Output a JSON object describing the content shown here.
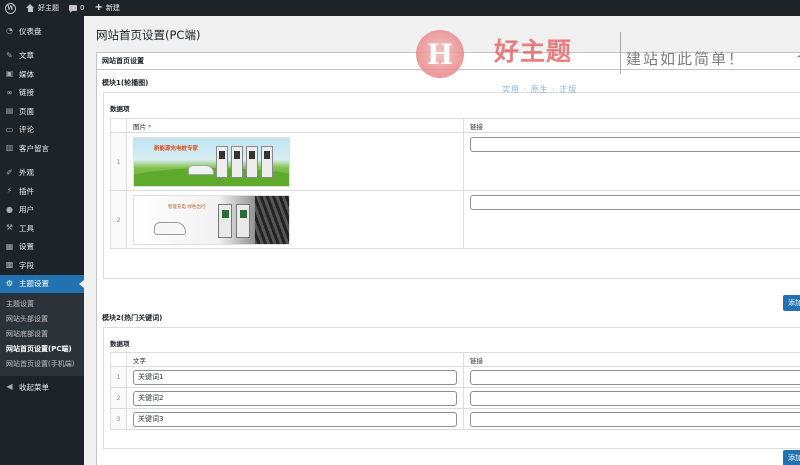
{
  "adminbar": {
    "site_name": "好主题",
    "comments_count": "0",
    "new_label": "新建"
  },
  "sidebar": {
    "items": [
      {
        "label": "仪表盘",
        "icon": "dashboard-icon"
      },
      {
        "label": "文章",
        "icon": "pin-icon"
      },
      {
        "label": "媒体",
        "icon": "media-icon"
      },
      {
        "label": "链接",
        "icon": "link-icon"
      },
      {
        "label": "页面",
        "icon": "page-icon"
      },
      {
        "label": "评论",
        "icon": "comment-icon"
      },
      {
        "label": "客户留言",
        "icon": "message-icon"
      },
      {
        "label": "外观",
        "icon": "brush-icon"
      },
      {
        "label": "插件",
        "icon": "plugin-icon"
      },
      {
        "label": "用户",
        "icon": "user-icon"
      },
      {
        "label": "工具",
        "icon": "wrench-icon"
      },
      {
        "label": "设置",
        "icon": "settings-icon"
      },
      {
        "label": "字段",
        "icon": "field-icon"
      }
    ],
    "current": {
      "label": "主题设置",
      "icon": "gear-icon"
    },
    "submenu": [
      "主题设置",
      "网站头部设置",
      "网站底部设置",
      "网站首页设置(PC端)",
      "网站首页设置(手机端)"
    ],
    "collapse_label": "收起菜单"
  },
  "page": {
    "title": "网站首页设置(PC端)",
    "panel_title": "网站首页设置"
  },
  "module1": {
    "title": "模块1(轮播图)",
    "data_label": "数据项",
    "col_image": "图片",
    "col_link": "链接",
    "rows": [
      {
        "index": "1",
        "image_text": "新能源充电桩专家",
        "link": ""
      },
      {
        "index": "2",
        "image_text": "智能充电 绿色出行",
        "link": ""
      }
    ],
    "add_label": "添加"
  },
  "module2": {
    "title": "模块2(热门关键词)",
    "data_label": "数据项",
    "col_text": "文字",
    "col_link": "链接",
    "rows": [
      {
        "index": "1",
        "text": "关键词1",
        "link": ""
      },
      {
        "index": "2",
        "text": "关键词2",
        "link": ""
      },
      {
        "index": "3",
        "text": "关键词3",
        "link": ""
      }
    ],
    "add_label": "添加"
  },
  "watermark": {
    "letter": "H",
    "brand": "好主题",
    "sub": "实用 · 原生 · 正版",
    "slogan": "建站如此简单！"
  },
  "colors": {
    "sidebar_bg": "#1d2327",
    "accent": "#2271b1",
    "watermark_red": "#e56a6a"
  }
}
